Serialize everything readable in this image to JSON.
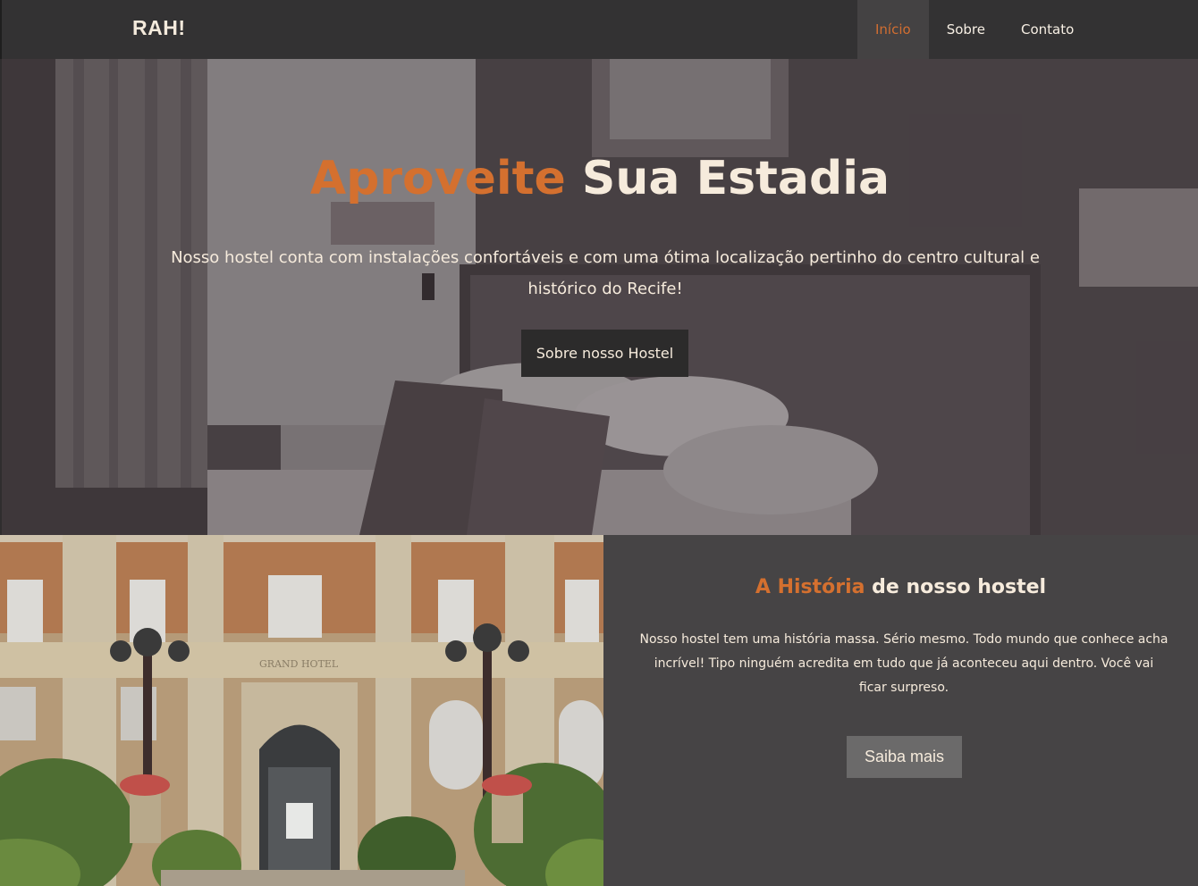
{
  "nav": {
    "brand": "RAH!",
    "items": [
      {
        "label": "Início",
        "active": true
      },
      {
        "label": "Sobre",
        "active": false
      },
      {
        "label": "Contato",
        "active": false
      }
    ]
  },
  "hero": {
    "title_accent": "Aproveite",
    "title_rest": " Sua Estadia",
    "text": "Nosso hostel conta com instalações confortáveis e com uma ótima localização pertinho do centro cultural e histórico do Recife!",
    "button": "Sobre nosso Hostel"
  },
  "history": {
    "title_accent": "A História",
    "title_rest": " de nosso hostel",
    "text": "Nosso hostel tem uma história massa. Sério mesmo. Todo mundo que conhece acha incrível! Tipo ninguém acredita em tudo que já aconteceu aqui dentro. Você vai ficar surpreso.",
    "button": "Saiba mais",
    "facade_sign": "GRAND HOTEL"
  },
  "colors": {
    "accent": "#d4702f",
    "text": "#f6ebdc",
    "navbar": "#333233",
    "panel": "#464445"
  }
}
